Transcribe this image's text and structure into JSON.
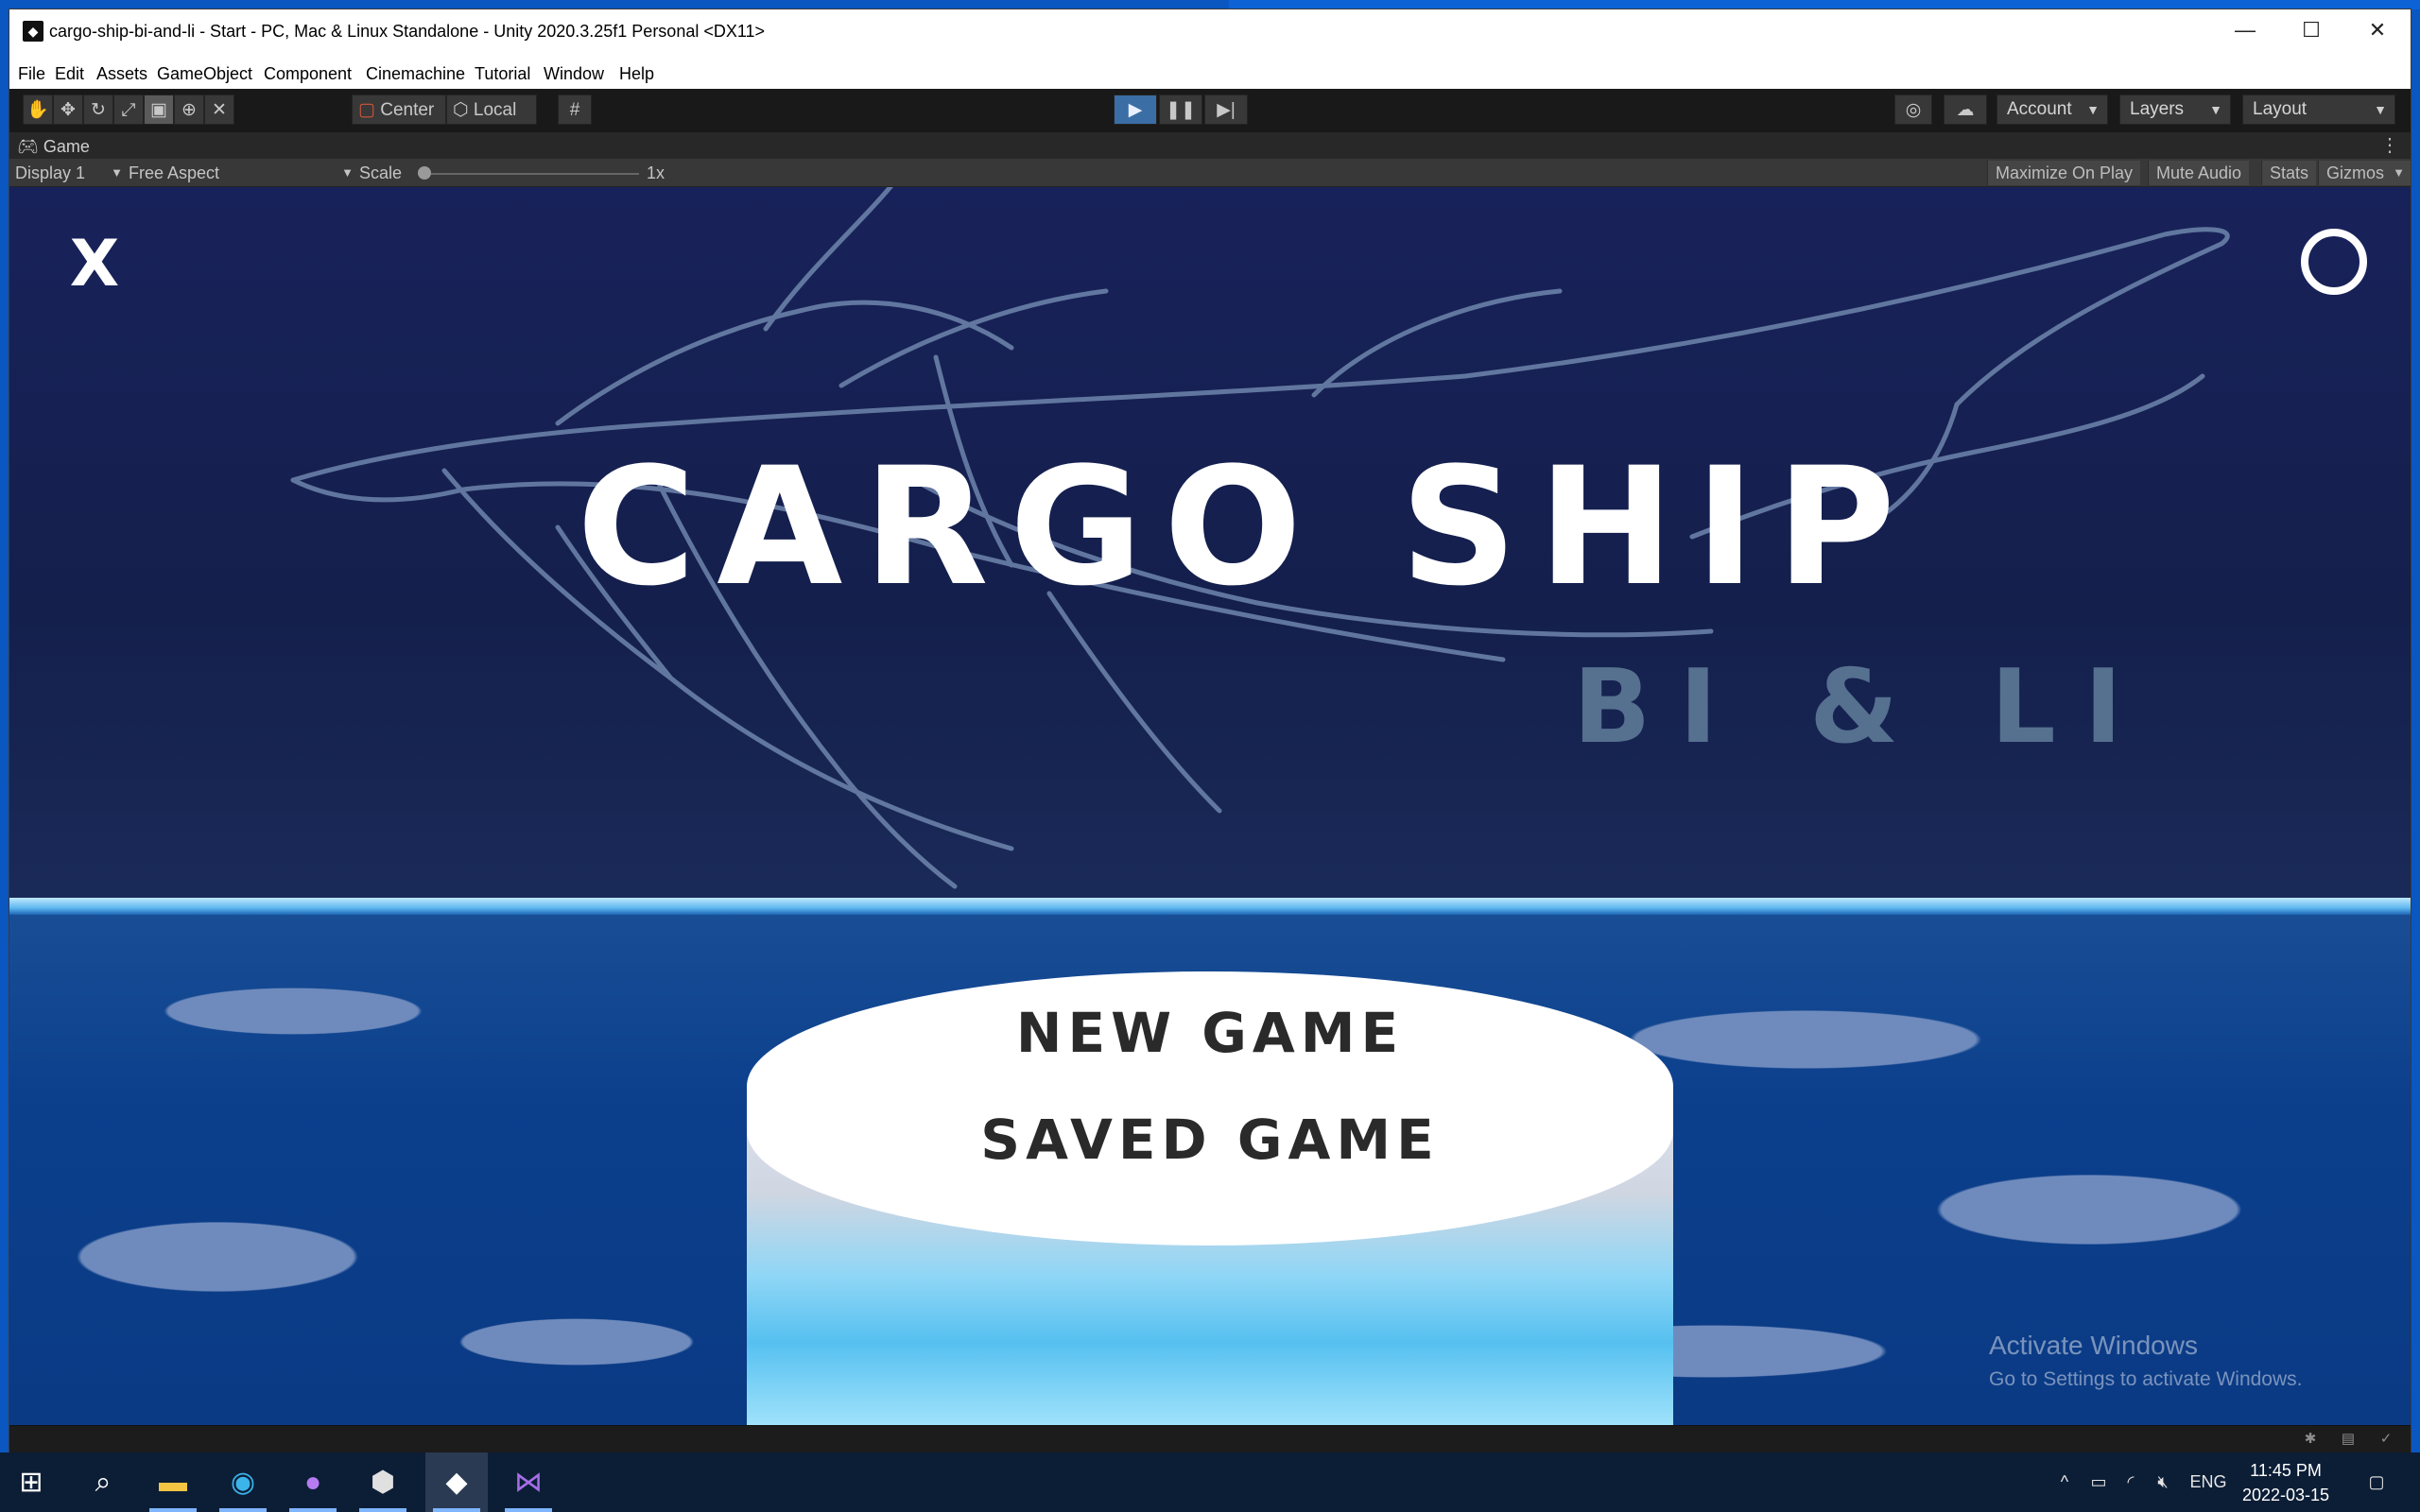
{
  "window": {
    "title": "cargo-ship-bi-and-li - Start - PC, Mac & Linux Standalone - Unity 2020.3.25f1 Personal <DX11>",
    "controls": {
      "minimize": "—",
      "maximize": "☐",
      "close": "✕"
    }
  },
  "menu": [
    "File",
    "Edit",
    "Assets",
    "GameObject",
    "Component",
    "Cinemachine",
    "Tutorial",
    "Window",
    "Help"
  ],
  "toolbar": {
    "tools": [
      "hand-tool-icon",
      "move-tool-icon",
      "rotate-tool-icon",
      "scale-tool-icon",
      "rect-tool-icon",
      "transform-tool-icon",
      "custom-tool-icon"
    ],
    "pivot_label": "Center",
    "space_label": "Local",
    "account_label": "Account",
    "layers_label": "Layers",
    "layout_label": "Layout",
    "colors": {
      "play_active": "#3a6ea5"
    }
  },
  "game_tab": {
    "label": "Game",
    "display": "Display 1",
    "aspect": "Free Aspect",
    "scale_label": "Scale",
    "scale_value": "1x",
    "maximize_on_play": "Maximize On Play",
    "mute_audio": "Mute Audio",
    "stats": "Stats",
    "gizmos": "Gizmos"
  },
  "game": {
    "close_glyph": "X",
    "title": "CARGO SHIP",
    "subtitle": "BI & LI",
    "menu_options": [
      "NEW GAME",
      "SAVED GAME"
    ],
    "colors": {
      "sky": "#18225a",
      "sea": "#0b3f8c",
      "subtitle": "#56708f"
    }
  },
  "watermark": {
    "title": "Activate Windows",
    "subtitle": "Go to Settings to activate Windows."
  },
  "taskbar": {
    "apps": [
      "windows-start-icon",
      "search-icon",
      "file-explorer-icon",
      "edge-icon",
      "github-desktop-icon",
      "unity-hub-icon",
      "unity-editor-icon",
      "visual-studio-icon"
    ],
    "language": "ENG",
    "time": "11:45 PM",
    "date": "2022-03-15"
  }
}
